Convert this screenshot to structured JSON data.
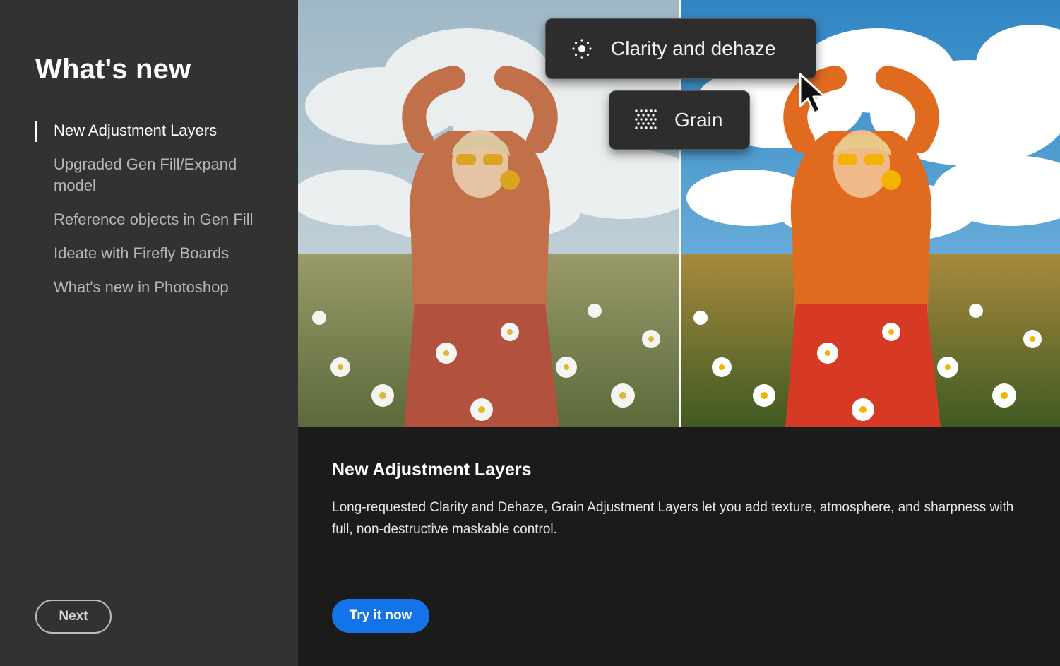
{
  "sidebar": {
    "title": "What's new",
    "items": [
      {
        "label": "New Adjustment Layers",
        "active": true
      },
      {
        "label": "Upgraded Gen Fill/Expand model",
        "active": false
      },
      {
        "label": "Reference objects in Gen Fill",
        "active": false
      },
      {
        "label": "Ideate with Firefly Boards",
        "active": false
      },
      {
        "label": "What's new in Photoshop",
        "active": false
      }
    ],
    "next_label": "Next"
  },
  "hero": {
    "pills": {
      "clarity_label": "Clarity and dehaze",
      "grain_label": "Grain"
    },
    "icons": [
      "clarity-icon",
      "grain-icon",
      "mouse-cursor-icon"
    ]
  },
  "content": {
    "title": "New Adjustment Layers",
    "description": "Long-requested Clarity and Dehaze, Grain Adjustment Layers let you add texture, atmosphere, and sharpness with full, non-destructive maskable control.",
    "cta_label": "Try it now"
  },
  "colors": {
    "sidebar_bg": "#323232",
    "content_bg": "#1b1b1b",
    "accent": "#1473e6",
    "sweater": "#e06a1e",
    "skirt": "#d63a24"
  }
}
